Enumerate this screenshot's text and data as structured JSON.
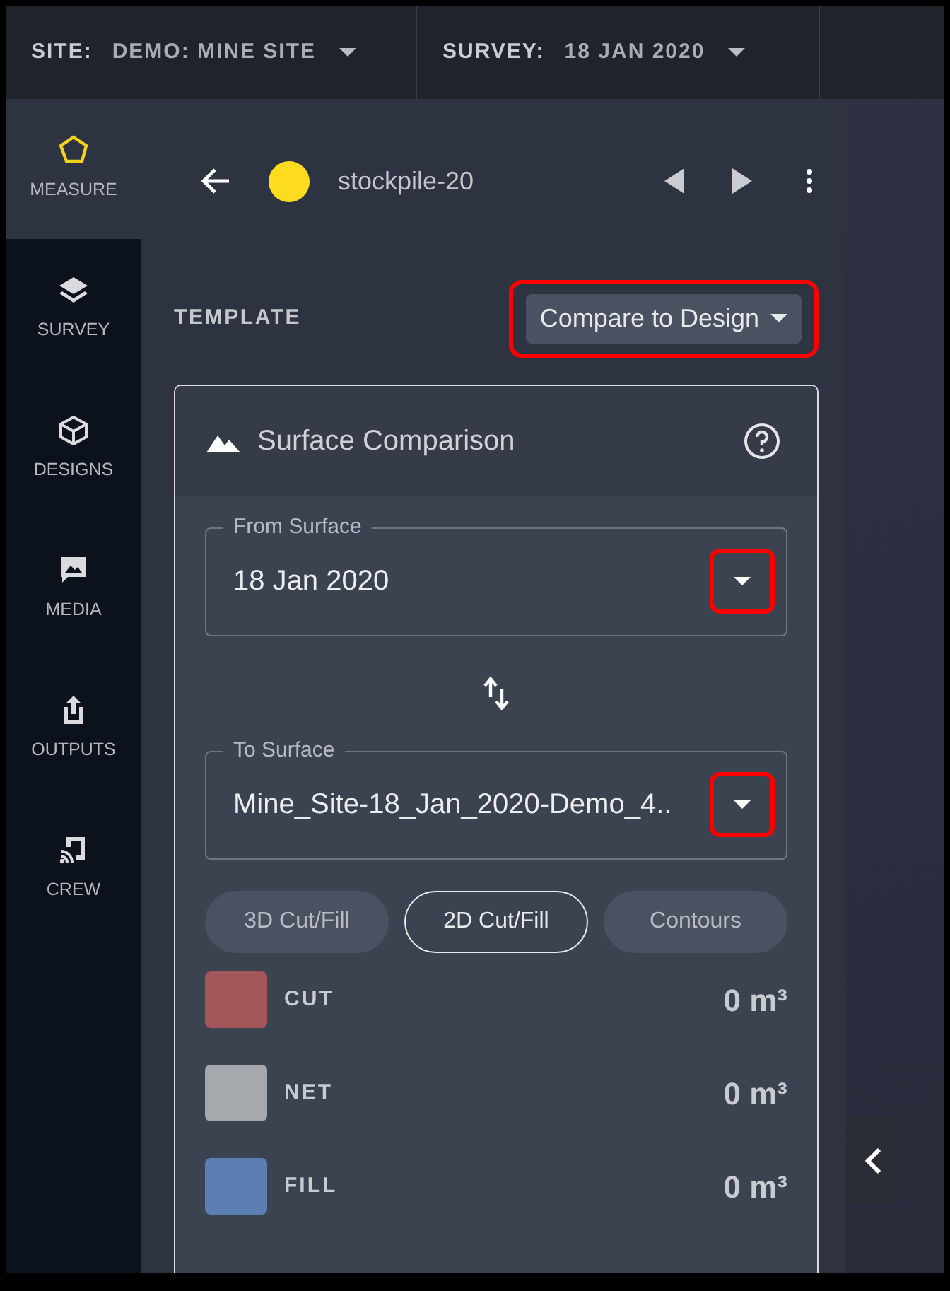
{
  "top_bar": {
    "site": {
      "label": "SITE:",
      "value": "DEMO: MINE SITE"
    },
    "survey": {
      "label": "SURVEY:",
      "value": "18 JAN 2020"
    }
  },
  "sidebar": {
    "items": [
      {
        "kind": "measure",
        "label": "MEASURE",
        "selected": true
      },
      {
        "kind": "survey",
        "label": "SURVEY",
        "selected": false
      },
      {
        "kind": "designs",
        "label": "DESIGNS",
        "selected": false
      },
      {
        "kind": "media",
        "label": "MEDIA",
        "selected": false
      },
      {
        "kind": "outputs",
        "label": "OUTPUTS",
        "selected": false
      },
      {
        "kind": "crew",
        "label": "CREW",
        "selected": false
      }
    ]
  },
  "header": {
    "name": "stockpile-20"
  },
  "template": {
    "label": "TEMPLATE",
    "value": "Compare to Design",
    "highlighted": true
  },
  "card": {
    "title": "Surface Comparison",
    "fields": [
      {
        "label": "From Surface",
        "value": "18 Jan 2020",
        "highlighted": true
      },
      {
        "label": "To Surface",
        "value": "Mine_Site-18_Jan_2020-Demo_4..",
        "highlighted": true
      }
    ],
    "modes": [
      {
        "label": "3D Cut/Fill",
        "selected": false
      },
      {
        "label": "2D Cut/Fill",
        "selected": true
      },
      {
        "label": "Contours",
        "selected": false
      }
    ],
    "legend": [
      {
        "label": "CUT",
        "value": "0 m³",
        "color": "#a5565a"
      },
      {
        "label": "NET",
        "value": "0 m³",
        "color": "#a4a9ae"
      },
      {
        "label": "FILL",
        "value": "0 m³",
        "color": "#5b7fb3"
      }
    ]
  }
}
